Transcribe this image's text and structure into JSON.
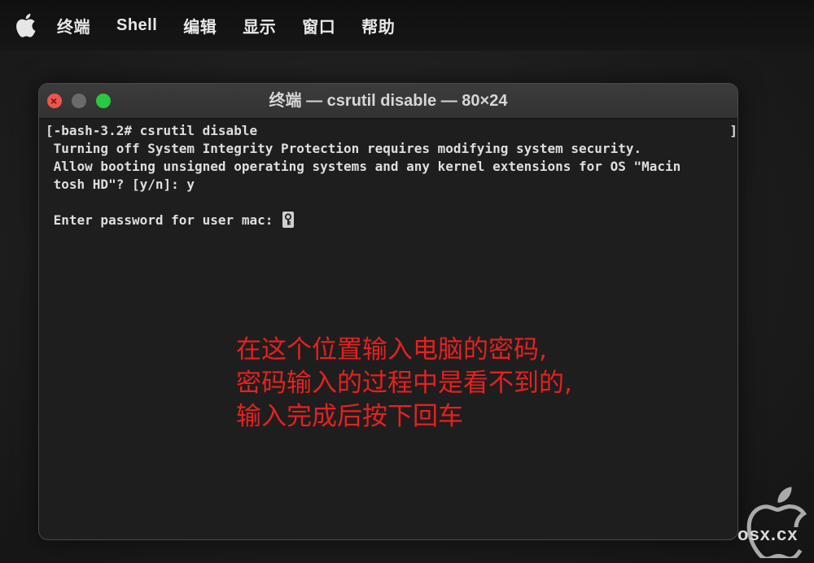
{
  "menubar": {
    "apple_icon": "apple-logo-icon",
    "items": [
      "终端",
      "Shell",
      "编辑",
      "显示",
      "窗口",
      "帮助"
    ]
  },
  "window": {
    "title": "终端 — csrutil disable — 80×24",
    "traffic_lights": {
      "close_color": "#f0544c",
      "minimize_color": "#6a6a6a",
      "maximize_color": "#2ac840"
    }
  },
  "terminal": {
    "lines": [
      "[-bash-3.2# csrutil disable",
      " Turning off System Integrity Protection requires modifying system security.",
      " Allow booting unsigned operating systems and any kernel extensions for OS \"Macin",
      " tosh HD\"? [y/n]: y",
      "",
      " Enter password for user mac: "
    ],
    "right_bracket": "]",
    "cursor_icon": "key-lock-icon"
  },
  "annotation": {
    "color": "#e4211f",
    "lines": [
      "在这个位置输入电脑的密码,",
      "密码输入的过程中是看不到的,",
      "输入完成后按下回车"
    ]
  },
  "watermark": {
    "text": "osx.cx",
    "icon": "apple-logo-icon"
  }
}
